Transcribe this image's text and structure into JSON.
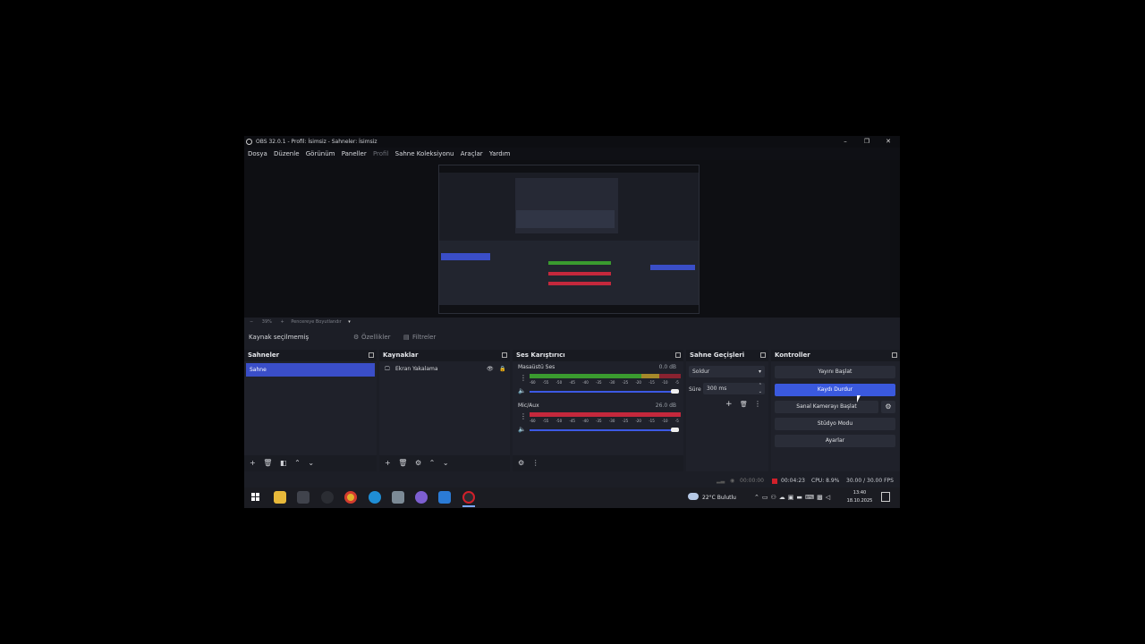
{
  "window": {
    "title": "OBS 32.0.1 - Profil: İsimsiz - Sahneler: İsimsiz",
    "minimize_icon": "–",
    "restore_icon": "❐",
    "close_icon": "✕"
  },
  "menu": {
    "items": [
      {
        "label": "Dosya",
        "dim": false
      },
      {
        "label": "Düzenle",
        "dim": false
      },
      {
        "label": "Görünüm",
        "dim": false
      },
      {
        "label": "Paneller",
        "dim": false
      },
      {
        "label": "Profil",
        "dim": true
      },
      {
        "label": "Sahne Koleksiyonu",
        "dim": false
      },
      {
        "label": "Araçlar",
        "dim": false
      },
      {
        "label": "Yardım",
        "dim": false
      }
    ]
  },
  "preview": {
    "zoom": "39%",
    "fit_label": "Pencereye Boyutlandır"
  },
  "context": {
    "no_source": "Kaynak seçilmemiş",
    "properties": "Özellikler",
    "filters": "Filtreler"
  },
  "scenes": {
    "title": "Sahneler",
    "items": [
      "Sahne"
    ]
  },
  "sources": {
    "title": "Kaynaklar",
    "items": [
      "Ekran Yakalama"
    ]
  },
  "mixer": {
    "title": "Ses Karıştırıcı",
    "scale": [
      "-60",
      "-55",
      "-50",
      "-45",
      "-40",
      "-35",
      "-30",
      "-25",
      "-20",
      "-15",
      "-10",
      "-5",
      "0"
    ],
    "channels": [
      {
        "name": "Masaüstü Ses",
        "level": "0.0 dB"
      },
      {
        "name": "Mic/Aux",
        "level": "26.0 dB"
      }
    ]
  },
  "transitions": {
    "title": "Sahne Geçişleri",
    "selected": "Soldur",
    "duration_label": "Süre",
    "duration_value": "300 ms"
  },
  "controls": {
    "title": "Kontroller",
    "start_stream": "Yayını Başlat",
    "stop_record": "Kaydı Durdur",
    "virtual_cam": "Sanal Kamerayı Başlat",
    "studio_mode": "Stüdyo Modu",
    "settings": "Ayarlar"
  },
  "status": {
    "stream_time": "00:00:00",
    "record_time": "00:04:23",
    "cpu": "CPU: 8.9%",
    "fps": "30.00 / 30.00 FPS"
  },
  "taskbar": {
    "weather": "22°C  Bulutlu",
    "time": "13:40",
    "date": "18.10.2025"
  },
  "colors": {
    "accent": "#3a4ec8",
    "record": "#d0202a",
    "meter_green": "#3a9b2f",
    "meter_red": "#c4283c"
  }
}
